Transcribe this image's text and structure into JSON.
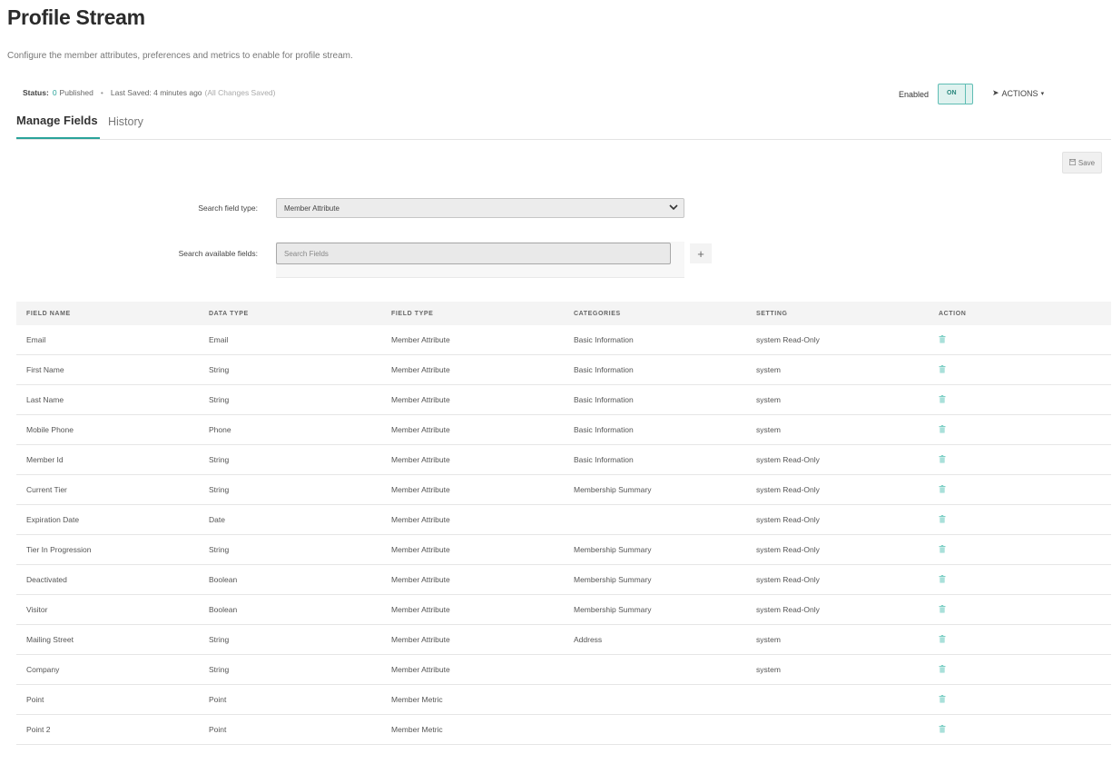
{
  "page": {
    "title": "Profile Stream",
    "description": "Configure the member attributes, preferences and metrics to enable for profile stream."
  },
  "status": {
    "label": "Status:",
    "count": "0",
    "state": "Published",
    "separator": "•",
    "last_saved": "Last Saved: 4 minutes ago",
    "saved_note": "(All Changes Saved)"
  },
  "toggle": {
    "label": "Enabled",
    "value": "ON"
  },
  "actions": {
    "label": "ACTIONS"
  },
  "tabs": [
    {
      "label": "Manage Fields",
      "active": true
    },
    {
      "label": "History",
      "active": false
    }
  ],
  "toolbar": {
    "save_label": "Save"
  },
  "search": {
    "field_type_label": "Search field type:",
    "field_type_value": "Member Attribute",
    "available_label": "Search available fields:",
    "placeholder": "Search Fields"
  },
  "colors": {
    "accent": "#2aa39a",
    "toggle_bg": "#dff2ef",
    "trash_icon": "#7fcfc6"
  },
  "table": {
    "headers": [
      "FIELD NAME",
      "DATA TYPE",
      "FIELD TYPE",
      "CATEGORIES",
      "SETTING",
      "ACTION"
    ],
    "rows": [
      [
        "Email",
        "Email",
        "Member Attribute",
        "Basic Information",
        "system Read-Only"
      ],
      [
        "First Name",
        "String",
        "Member Attribute",
        "Basic Information",
        "system"
      ],
      [
        "Last Name",
        "String",
        "Member Attribute",
        "Basic Information",
        "system"
      ],
      [
        "Mobile Phone",
        "Phone",
        "Member Attribute",
        "Basic Information",
        "system"
      ],
      [
        "Member Id",
        "String",
        "Member Attribute",
        "Basic Information",
        "system Read-Only"
      ],
      [
        "Current Tier",
        "String",
        "Member Attribute",
        "Membership Summary",
        "system Read-Only"
      ],
      [
        "Expiration Date",
        "Date",
        "Member Attribute",
        "",
        "system Read-Only"
      ],
      [
        "Tier In Progression",
        "String",
        "Member Attribute",
        "Membership Summary",
        "system Read-Only"
      ],
      [
        "Deactivated",
        "Boolean",
        "Member Attribute",
        "Membership Summary",
        "system Read-Only"
      ],
      [
        "Visitor",
        "Boolean",
        "Member Attribute",
        "Membership Summary",
        "system Read-Only"
      ],
      [
        "Mailing Street",
        "String",
        "Member Attribute",
        "Address",
        "system"
      ],
      [
        "Company",
        "String",
        "Member Attribute",
        "",
        "system"
      ],
      [
        "Point",
        "Point",
        "Member Metric",
        "",
        ""
      ],
      [
        "Point 2",
        "Point",
        "Member Metric",
        "",
        ""
      ]
    ]
  }
}
